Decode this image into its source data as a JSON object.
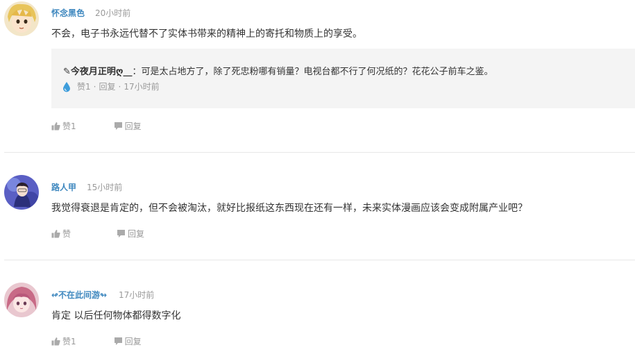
{
  "comments": [
    {
      "username": "怀念黑色",
      "time": "20小时前",
      "content": "不会，电子书永远代替不了实体书带来的精神上的寄托和物质上的享受。",
      "quote": {
        "user": "✎今夜月正明ღ__",
        "text": "：可是太占地方了，除了死忠粉哪有销量？电视台都不行了何况纸的？花花公子前车之鉴。",
        "like_label": "赞1",
        "reply_label": "回复",
        "time": "17小时前"
      },
      "like_label": "赞1",
      "reply_label": "回复"
    },
    {
      "username": "路人甲",
      "time": "15小时前",
      "content": "我觉得衰退是肯定的，但不会被淘汰，就好比报纸这东西现在还有一样，未来实体漫画应该会变成附属产业吧？",
      "like_label": "赞",
      "reply_label": "回复"
    },
    {
      "username": "↫不在此间游↬",
      "time": "17小时前",
      "content": "肯定 以后任何物体都得数字化",
      "like_label": "赞1",
      "reply_label": "回复"
    }
  ],
  "separator": "·",
  "colors": {
    "username": "#3f88bf",
    "meta": "#999999",
    "quote_bg": "#f4f4f4",
    "drop": "#3e9ddb"
  },
  "icons": [
    "thumbs-up-icon",
    "comment-bubble-icon",
    "water-drop-icon"
  ]
}
